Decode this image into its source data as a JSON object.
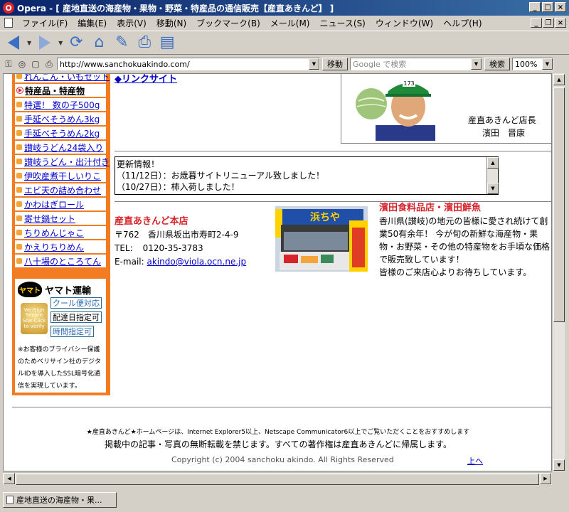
{
  "window": {
    "title": "Opera - [ 産地直送の海産物・果物・野菜・特産品の通信販売【産直あきんど】 ]",
    "app_icon": "O"
  },
  "menu": [
    "ファイル(F)",
    "編集(E)",
    "表示(V)",
    "移動(N)",
    "ブックマーク(B)",
    "メール(M)",
    "ニュース(S)",
    "ウィンドウ(W)",
    "ヘルプ(H)"
  ],
  "address": {
    "url": "http://www.sanchokuakindo.com/",
    "go_label": "移動",
    "search_placeholder": "Google で検索",
    "search_label": "検索",
    "zoom": "100%"
  },
  "sidebar": {
    "items": [
      {
        "label": "れんこん・いもセット",
        "type": "link"
      },
      {
        "label": "特産品・特産物",
        "type": "head"
      },
      {
        "label": "特選！ 数の子500g",
        "type": "link"
      },
      {
        "label": "手延べそうめん3kg",
        "type": "link"
      },
      {
        "label": "手延べそうめん2kg",
        "type": "link"
      },
      {
        "label": "讃岐うどん24袋入り",
        "type": "link"
      },
      {
        "label": "讃岐うどん・出汁付き",
        "type": "link"
      },
      {
        "label": "伊吹産煮干しいりこ",
        "type": "link"
      },
      {
        "label": "エビ天の詰め合わせ",
        "type": "link"
      },
      {
        "label": "かわはぎロール",
        "type": "link"
      },
      {
        "label": "寄せ鍋セット",
        "type": "link"
      },
      {
        "label": "ちりめんじゃこ",
        "type": "link"
      },
      {
        "label": "かえりちりめん",
        "type": "link"
      },
      {
        "label": "八十場のところてん",
        "type": "link"
      }
    ],
    "yamato": "ヤマト運輸",
    "yamato_cat": "ヤマト",
    "verisign": "VeriSign Secure Site Click to verify",
    "options": [
      "クール便対応",
      "配達日指定可",
      "時間指定可"
    ],
    "note": "※お客様のプライバシー保護のためベリサイン社のデジタルIDを導入したSSL暗号化通信を実現しています。"
  },
  "link_site": "◆リンクサイト",
  "manager": {
    "title": "産直あきんど店長",
    "name": "濱田　晋康",
    "cap_number": "173"
  },
  "news": {
    "heading": "更新情報！",
    "items": [
      "（11/12日）：お歳暮サイトリニューアル致しました！",
      "（10/27日）：柿入荷しました！"
    ]
  },
  "store": {
    "name": "産直あきんど本店",
    "address": "〒762　香川県坂出市寿町2-4-9",
    "tel_label": "TEL:",
    "tel": "0120-35-3783",
    "email_label": "E-mail:",
    "email": "akindo@viola.ocn.ne.jp"
  },
  "shop_sign": "浜ちや",
  "hamada": {
    "name": "濱田食料品店・濱田鮮魚",
    "desc": "香川県(讃岐)の地元の皆様に愛され続けて創業50有余年！ 今が旬の新鮮な海産物・果物・お野菜・その他の特産物をお手頃な価格で販売致しています！",
    "welcome": "皆様のご来店心よりお待ちしています。"
  },
  "footer": {
    "browser_note": "★産直あきんど★ホームページは、Internet Explorer5以上、Netscape Communicator6以上でご覧いただくことをおすすめします",
    "copyright_note": "掲載中の記事・写真の無断転載を禁じます。すべての著作権は産直あきんどに帰属します。",
    "copyright": "Copyright (c) 2004 sanchoku akindo. All Rights Reserved",
    "to_top": "上へ"
  },
  "statusbar": {
    "tab_label": "産地直送の海産物・果..."
  },
  "colors": {
    "sidebar_orange": "#f37b21",
    "accent_red": "#d9232a",
    "link_blue": "#0000cc",
    "titlebar_blue": "#0a246a"
  }
}
